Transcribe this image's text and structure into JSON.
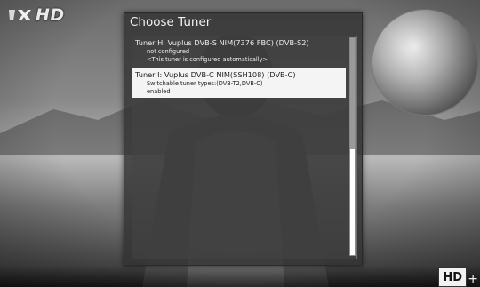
{
  "logo": {
    "mark_icon": "tvx-logo-icon",
    "text": "HD"
  },
  "dialog": {
    "title": "Choose Tuner",
    "tuners": [
      {
        "name": "Tuner H: Vuplus DVB-S NIM(7376 FBC) (DVB-S2)",
        "status": "not configured",
        "note": "<This tuner is configured automatically>",
        "selected": false
      },
      {
        "name": "Tuner I: Vuplus DVB-C NIM(SSH108) (DVB-C)",
        "types": "Switchable tuner types:(DVB-T2,DVB-C)",
        "status": "enabled",
        "selected": true
      }
    ]
  },
  "badges": {
    "hd": "HD",
    "plus": "+"
  },
  "colors": {
    "dialog_bg": "#323232",
    "selection_bg": "#f4f4f4",
    "text_light": "#ececec"
  }
}
